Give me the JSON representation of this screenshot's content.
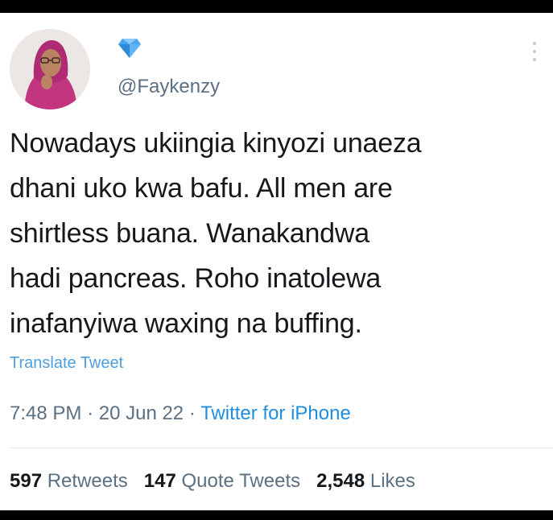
{
  "tweet": {
    "handle": "@Faykenzy",
    "text": "Nowadays ukiingia kinyozi unaeza\ndhani uko kwa bafu. All men are\nshirtless buana. Wanakandwa\nhadi pancreas. Roho inatolewa\ninafanyiwa waxing na buffing.",
    "translate_label": "Translate Tweet",
    "time": "7:48 PM",
    "date": "20 Jun 22",
    "separator": "·",
    "source": "Twitter for iPhone"
  },
  "stats": {
    "retweets_count": "597",
    "retweets_label": "Retweets",
    "quotes_count": "147",
    "quotes_label": "Quote Tweets",
    "likes_count": "2,548",
    "likes_label": "Likes"
  },
  "icons": {
    "verified": "diamond-badge-icon",
    "more": "more-vertical-icon"
  },
  "colors": {
    "link": "#1d8ee0",
    "secondary_text": "#5b7083",
    "primary_text": "#16181b",
    "badge": "#4aa6f0"
  }
}
